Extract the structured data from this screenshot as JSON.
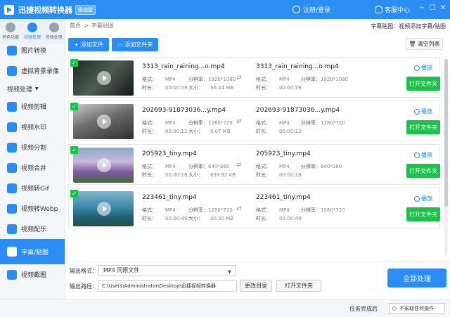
{
  "app": {
    "title": "迅捷视频转换器",
    "badge": "极速版",
    "login": "注册/登录",
    "customer_service": "客服中心",
    "accent": "#2b8cf3",
    "green": "#1bc14a"
  },
  "window_controls": [
    "−",
    "☐",
    "✕"
  ],
  "sidebar": {
    "top_icons": [
      {
        "label": "特色功能",
        "icon": "star-icon"
      },
      {
        "label": "视频处理",
        "icon": "video-icon"
      },
      {
        "label": "音频处理",
        "icon": "audio-icon"
      }
    ],
    "items_before": [
      {
        "label": "图片转换",
        "icon": "image-icon"
      },
      {
        "label": "虚拟背景录像",
        "icon": "camera-icon"
      }
    ],
    "section": "视频处理",
    "items": [
      {
        "label": "视频剪辑",
        "icon": "scissors-icon"
      },
      {
        "label": "视频水印",
        "icon": "watermark-icon"
      },
      {
        "label": "视频分割",
        "icon": "split-icon"
      },
      {
        "label": "视频合并",
        "icon": "merge-icon"
      },
      {
        "label": "视频转Gif",
        "icon": "gif-icon"
      },
      {
        "label": "视频转Webp",
        "icon": "webp-icon"
      },
      {
        "label": "视频配乐",
        "icon": "music-icon"
      },
      {
        "label": "字幕/贴图",
        "icon": "subtitle-icon",
        "active": true
      },
      {
        "label": "视频截图",
        "icon": "screenshot-icon"
      }
    ]
  },
  "breadcrumb": {
    "home": "首页",
    "sep": ">",
    "current": "字幕贴图",
    "right": "字幕贴图：视频添加字幕/贴图"
  },
  "toolbar": {
    "add_file": "添加文件",
    "add_folder": "添加文件夹",
    "clear_list": "清空列表"
  },
  "labels": {
    "format": "格式：",
    "resolution": "分辨率：",
    "duration": "时长：",
    "size": "大小：",
    "play": "播放",
    "open_folder": "打开文件夹"
  },
  "files": [
    {
      "name": "3313_rain_raining...o.mp4",
      "format": "MP4",
      "resolution": "1920*1080",
      "duration": "00:00:59",
      "size": "56.44 MB",
      "out_name": "3313_rain_raining...o.mp4",
      "out_format": "MP4",
      "out_resolution": "1920*1080",
      "out_duration": "00:00:59"
    },
    {
      "name": "202693-91873036...y.mp4",
      "format": "MP4",
      "resolution": "1280*720",
      "duration": "00:00:12",
      "size": "3.07 MB",
      "out_name": "202693-91873036...y.mp4",
      "out_format": "MP4",
      "out_resolution": "1280*720",
      "out_duration": "00:00:12"
    },
    {
      "name": "205923_tiny.mp4",
      "format": "MP4",
      "resolution": "640*360",
      "duration": "00:00:18",
      "size": "697.92 KB",
      "out_name": "205923_tiny.mp4",
      "out_format": "MP4",
      "out_resolution": "640*360",
      "out_duration": "00:00:18"
    },
    {
      "name": "223461_tiny.mp4",
      "format": "MP4",
      "resolution": "1280*720",
      "duration": "00:00:49",
      "size": "30.50 MB",
      "out_name": "223461_tiny.mp4",
      "out_format": "MP4",
      "out_resolution": "1280*720",
      "out_duration": "00:00:49"
    }
  ],
  "output": {
    "format_label": "输出格式：",
    "format_value": "MP4  同原文件",
    "path_label": "输出路径：",
    "path_value": "C:\\Users\\Administrator\\Desktop\\迅捷视频转换器",
    "change_dir": "更改目录",
    "open_folder": "打开文件夹",
    "convert_all": "全部处理"
  },
  "status": {
    "done_label": "任务完成后",
    "done_value": "不采取任何操作"
  }
}
